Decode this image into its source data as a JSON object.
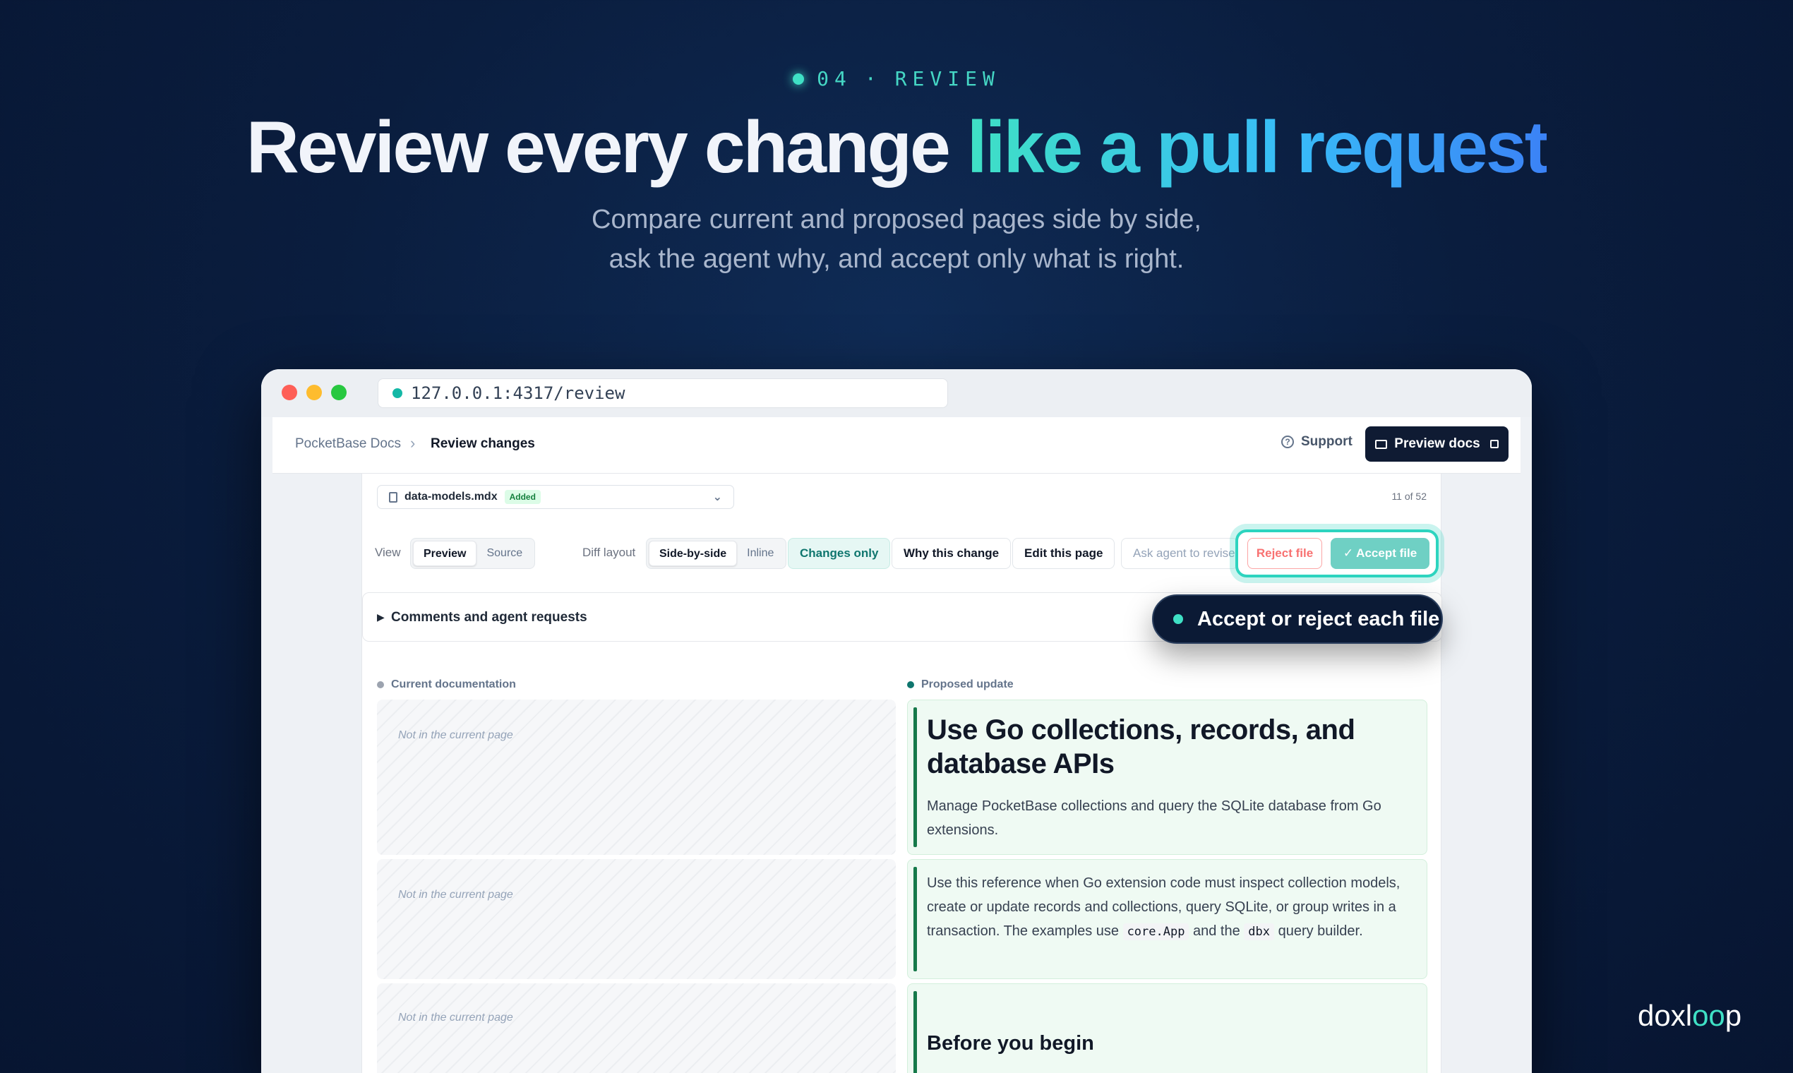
{
  "hero": {
    "step_number": "04",
    "step_separator": "·",
    "step_label": "REVIEW",
    "headline_plain": "Review every change ",
    "headline_accent": "like a pull request",
    "subtitle_line1": "Compare current and proposed pages side by side,",
    "subtitle_line2": "ask the agent why, and accept only what is right."
  },
  "browser": {
    "url": "127.0.0.1:4317/review"
  },
  "nav": {
    "breadcrumb_root": "PocketBase Docs",
    "breadcrumb_separator": "›",
    "breadcrumb_current": "Review changes",
    "support_label": "Support",
    "preview_docs_label": "Preview docs"
  },
  "file": {
    "name": "data-models.mdx",
    "status": "Added",
    "counter": "11 of 52"
  },
  "toolbar": {
    "view_label": "View",
    "view_options": [
      "Preview",
      "Source"
    ],
    "diff_layout_label": "Diff layout",
    "diff_options": [
      "Side-by-side",
      "Inline"
    ],
    "changes_only": "Changes only",
    "why_this_change": "Why this change",
    "edit_this_page": "Edit this page",
    "ask_agent": "Ask agent to revise",
    "reject_file": "Reject file",
    "accept_file": "✓  Accept file"
  },
  "comments": {
    "label": "Comments and agent requests"
  },
  "callout": {
    "text": "Accept or reject each file"
  },
  "diff": {
    "current_header": "Current documentation",
    "proposed_header": "Proposed update",
    "not_in_current": "Not in the current page",
    "proposed": {
      "title": "Use Go collections, records, and database APIs",
      "intro": "Manage PocketBase collections and query the SQLite database from Go extensions.",
      "para_a": "Use this reference when Go extension code must inspect collection models, create or update records and collections, query SQLite, or group writes in a transaction. The examples use ",
      "code1": "core.App",
      "para_b": " and the ",
      "code2": "dbx",
      "para_c": " query builder.",
      "section_heading": "Before you begin"
    }
  },
  "brand": {
    "name_a": "doxl",
    "name_b": "oo",
    "name_c": "p"
  },
  "colors": {
    "accent_teal": "#3fe0c5",
    "accent_blue": "#3b82f6",
    "proposed_bar": "#16794a",
    "reject": "#f87171",
    "accept": "#6fd0c4"
  }
}
